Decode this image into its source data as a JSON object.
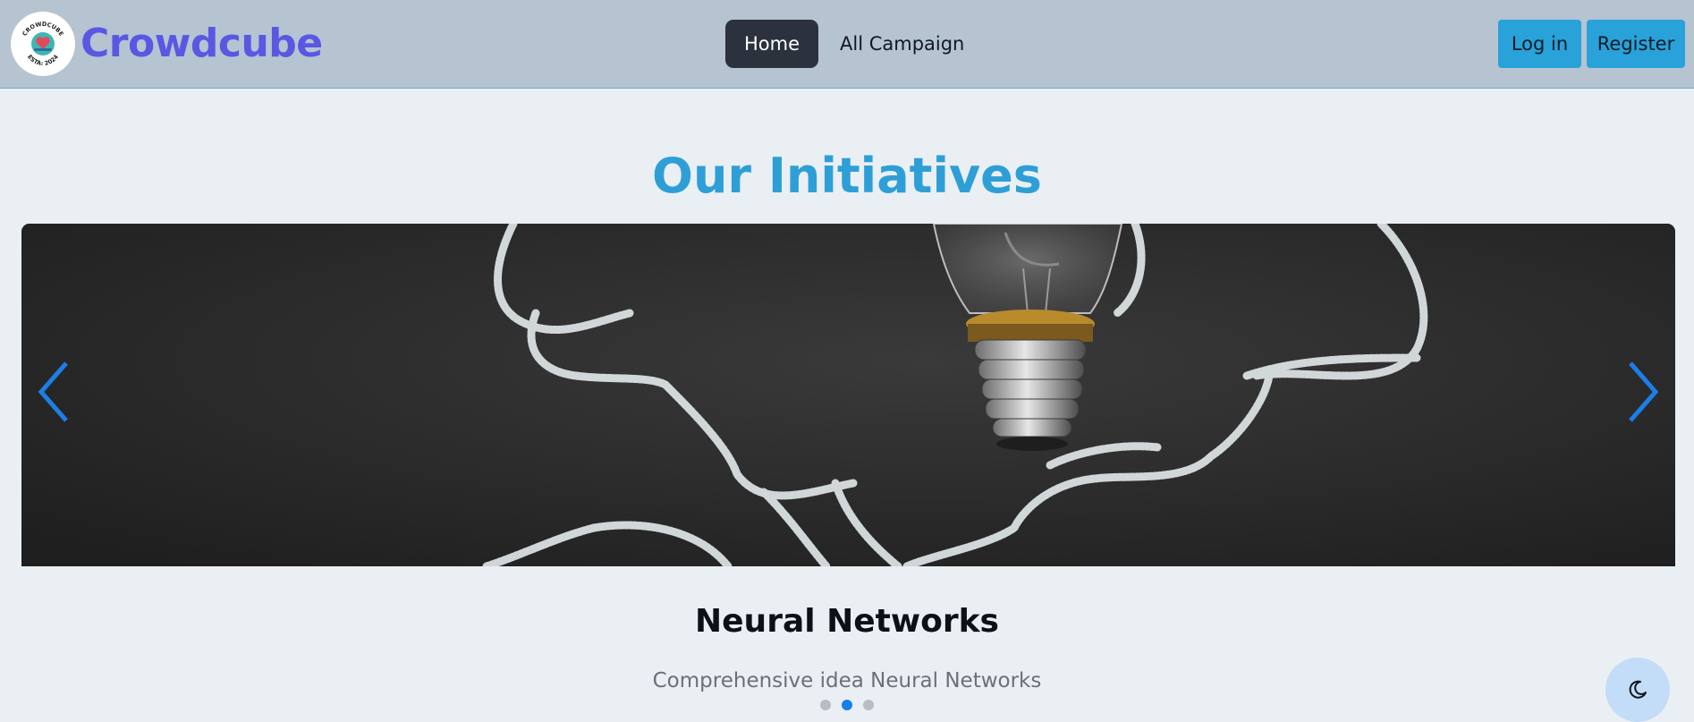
{
  "navbar": {
    "brand": "Crowdcube",
    "logo_text_top": "CROWDCUBE",
    "logo_text_bottom": "ESTA: 2024",
    "links": {
      "home": "Home",
      "all_campaign": "All Campaign"
    },
    "login_label": "Log in",
    "register_label": "Register"
  },
  "main": {
    "heading": "Our Initiatives",
    "carousel": {
      "slide_title": "Neural Networks",
      "slide_description": "Comprehensive idea Neural Networks",
      "dot_count": 3,
      "active_index": 1,
      "prev_icon": "chevron-left-icon",
      "next_icon": "chevron-right-icon"
    }
  },
  "theme_toggle": {
    "icon": "moon-icon"
  },
  "colors": {
    "navbar_bg": "#b6c3d1",
    "brand": "#5b57e3",
    "heading": "#2e9fd6",
    "button": "#28a2d9",
    "active_nav": "#2b313d",
    "dot_active": "#1c7ee8",
    "arrow": "#1c7ee8",
    "page_bg": "#eaeff3"
  }
}
